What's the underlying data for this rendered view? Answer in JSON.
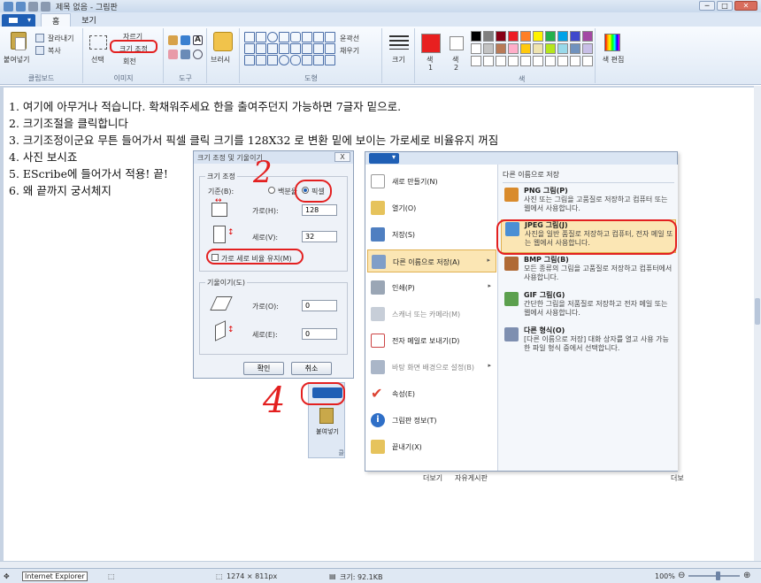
{
  "window": {
    "title": "제목 없음 - 그림판",
    "controls": [
      "─",
      "□",
      "✕"
    ]
  },
  "tabs": {
    "home": "홈",
    "view": "보기"
  },
  "ribbon": {
    "clipboard": {
      "paste": "붙여넣기",
      "cut": "잘라내기",
      "copy": "복사",
      "label": "클립보드"
    },
    "image": {
      "select": "선택",
      "crop": "자르기",
      "resize": "크기 조정",
      "rotate": "회전",
      "label": "이미지"
    },
    "tools": {
      "label": "도구"
    },
    "brushes": {
      "label": "브러시"
    },
    "shapes": {
      "outline": "윤곽선",
      "fill": "채우기",
      "label": "도형"
    },
    "size": {
      "label": "크기"
    },
    "colors": {
      "color1": "색",
      "color1_num": "1",
      "color2": "색",
      "color2_num": "2",
      "edit": "색 편집",
      "label": "색"
    },
    "palette": [
      "#000000",
      "#7f7f7f",
      "#880015",
      "#ed1c24",
      "#ff7f27",
      "#fff200",
      "#22b14c",
      "#00a2e8",
      "#3f48cc",
      "#a349a4",
      "#ffffff",
      "#c3c3c3",
      "#b97a57",
      "#ffaec9",
      "#ffc90e",
      "#efe4b0",
      "#b5e61d",
      "#99d9ea",
      "#7092be",
      "#c8bfe7",
      "#ffffff",
      "#ffffff",
      "#ffffff",
      "#ffffff",
      "#ffffff",
      "#ffffff",
      "#ffffff",
      "#ffffff",
      "#ffffff",
      "#ffffff"
    ]
  },
  "notes": [
    "1. 여기에 아무거나 적습니다. 확채워주세요 한을 출여주던지 가능하면 7글자 밑으로.",
    "2. 크기조절을 클릭합니다",
    "3. 크기조정이군요 무튼 들어가서 픽셀 클릭 크기를 128X32 로 변환 밑에 보이는 가로세로 비율유지 꺼짐",
    "4. 사진 보시죠",
    "5. EScribe에 들어가서 적용! 끝!",
    "6. 왜 끝까지 궁서체지"
  ],
  "resize_dialog": {
    "title": "크기 조정 및 기울이기",
    "close": "X",
    "resize_legend": "크기 조정",
    "basis": "기준(B):",
    "percent": "백분율",
    "pixel": "픽셀",
    "horizontal": "가로(H):",
    "horizontal_value": "128",
    "vertical": "세로(V):",
    "vertical_value": "32",
    "keep_ratio": "가로 세로 비율 유지(M)",
    "skew_legend": "기울이기(도)",
    "skew_h": "가로(O):",
    "skew_h_value": "0",
    "skew_v": "세로(E):",
    "skew_v_value": "0",
    "ok": "확인",
    "cancel": "취소"
  },
  "annotation": {
    "step2": "2",
    "step4": "4"
  },
  "file_menu": {
    "left": [
      {
        "label": "새로 만들기(N)"
      },
      {
        "label": "열기(O)"
      },
      {
        "label": "저장(S)"
      },
      {
        "label": "다른 이름으로 저장(A)",
        "chev": "▸"
      },
      {
        "label": "인쇄(P)",
        "chev": "▸"
      },
      {
        "label": "스캐너 또는 카메라(M)"
      },
      {
        "label": "전자 메일로 보내기(D)"
      },
      {
        "label": "바탕 화면 배경으로 설정(B)",
        "chev": "▸"
      },
      {
        "label": "속성(E)"
      },
      {
        "label": "그림판 정보(T)"
      },
      {
        "label": "끝내기(X)"
      }
    ],
    "right_title": "다른 이름으로 저장",
    "right": [
      {
        "title": "PNG 그림(P)",
        "desc": "사진 또는 그림을 고품질로 저장하고 컴퓨터 또는 웹에서 사용합니다."
      },
      {
        "title": "JPEG 그림(J)",
        "desc": "사진을 일반 품질로 저장하고 컴퓨터, 전자 메일 또는 웹에서 사용합니다."
      },
      {
        "title": "BMP 그림(B)",
        "desc": "모든 종류의 그림을 고품질로 저장하고 컴퓨터에서 사용합니다."
      },
      {
        "title": "GIF 그림(G)",
        "desc": "간단한 그림을 저품질로 저장하고 전자 메일 또는 웹에서 사용합니다."
      },
      {
        "title": "다른 형식(O)",
        "desc": "[다른 이름으로 저장] 대화 상자를 열고 사용 가능한 파일 형식 중에서 선택합니다."
      }
    ]
  },
  "mini_ribbon": {
    "paste": "붙여넣기",
    "label": "클"
  },
  "below_menu": {
    "view": "더보기",
    "free": "자유게시판",
    "more": "더보"
  },
  "status": {
    "ie": "Internet Explorer",
    "dimensions": "1274 × 811px",
    "size": "크기: 92.1KB",
    "zoom": "100%",
    "zoom_minus": "⊖",
    "zoom_plus": "⊕"
  }
}
